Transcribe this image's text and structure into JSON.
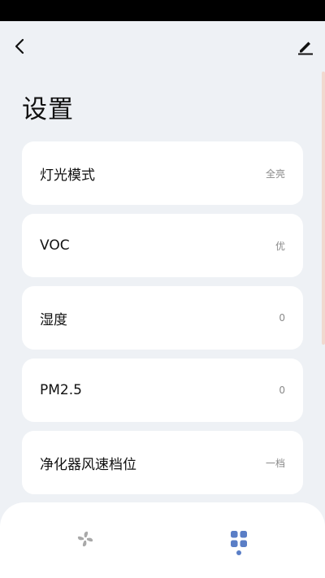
{
  "header": {
    "back_icon": "chevron-left-icon",
    "edit_icon": "pencil-icon"
  },
  "page": {
    "title": "设置"
  },
  "settings": {
    "items": [
      {
        "label": "灯光模式",
        "value": "全亮"
      },
      {
        "label": "VOC",
        "value": "优"
      },
      {
        "label": "湿度",
        "value": "0"
      },
      {
        "label": "PM2.5",
        "value": "0"
      },
      {
        "label": "净化器风速档位",
        "value": "一档"
      }
    ]
  },
  "bottom_nav": {
    "items": [
      {
        "icon": "fan-icon",
        "active": false
      },
      {
        "icon": "grid-dots-icon",
        "active": true
      }
    ],
    "accent_color": "#5a7ec6",
    "inactive_color": "#a9a9a9"
  }
}
